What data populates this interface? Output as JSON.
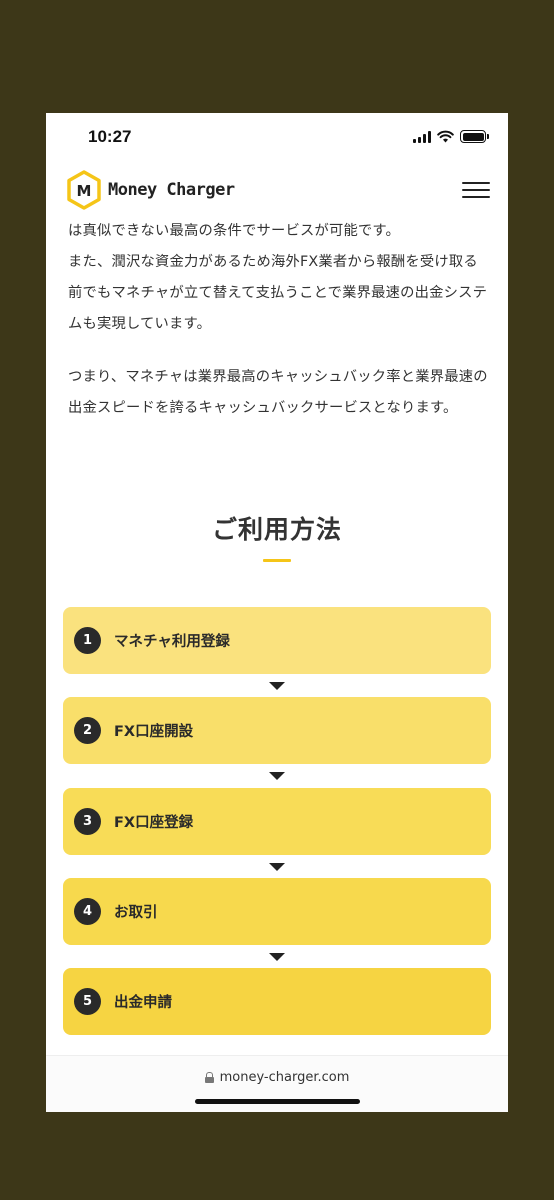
{
  "status": {
    "time": "10:27"
  },
  "header": {
    "brand": "Money Charger",
    "logo_letter": "M"
  },
  "intro": {
    "paragraphs": [
      "は真似できない最高の条件でサービスが可能です。\nまた、潤沢な資金力があるため海外FX業者から報酬を受け取る前でもマネチャが立て替えて支払うことで業界最速の出金システムも実現しています。",
      "つまり、マネチャは業界最高のキャッシュバック率と業界最速の出金スピードを誇るキャッシュバックサービスとなります。"
    ]
  },
  "section": {
    "title": "ご利用方法"
  },
  "steps": [
    {
      "num": "1",
      "label": "マネチャ利用登録",
      "color": "#fae27e"
    },
    {
      "num": "2",
      "label": "FX口座開設",
      "color": "#f9df6a"
    },
    {
      "num": "3",
      "label": "FX口座登録",
      "color": "#f8dc57"
    },
    {
      "num": "4",
      "label": "お取引",
      "color": "#f7d94d"
    },
    {
      "num": "5",
      "label": "出金申請",
      "color": "#f6d442"
    }
  ],
  "browser": {
    "url": "money-charger.com"
  },
  "colors": {
    "accent": "#f5c518",
    "frame": "#3d3718"
  }
}
